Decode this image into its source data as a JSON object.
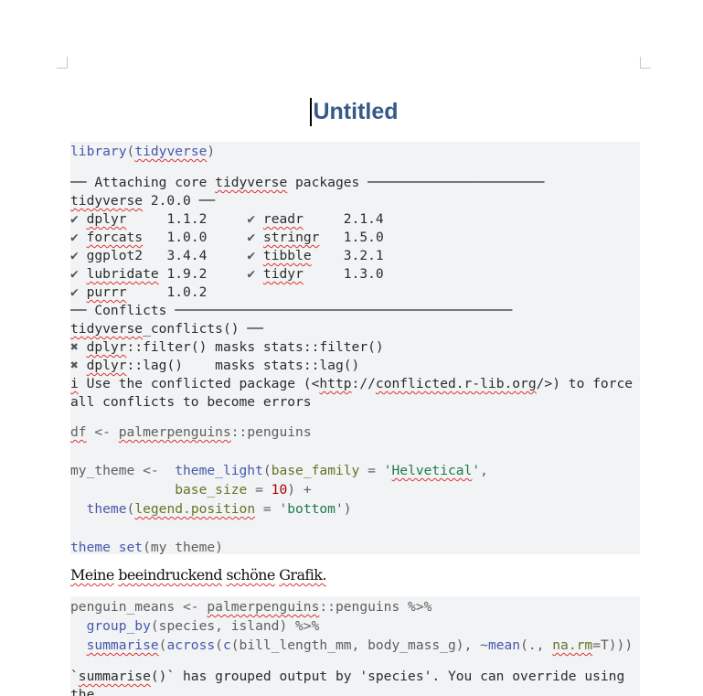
{
  "document": {
    "title": "Untitled",
    "paragraph": [
      [
        "Meine",
        "sp"
      ],
      [
        " "
      ],
      [
        "beeindruckend",
        "sp"
      ],
      [
        " "
      ],
      [
        "schöne",
        "sp"
      ],
      [
        " "
      ],
      [
        "Grafik.",
        "sp"
      ]
    ],
    "blocks": [
      {
        "chunks": [
          {
            "kind": "src",
            "gap": 0,
            "lines": [
              [
                [
                  "library",
                  "fn"
                ],
                [
                  "(",
                  "op"
                ],
                [
                  "tidyverse",
                  "fn sp"
                ],
                [
                  ")",
                  "op"
                ]
              ]
            ]
          },
          {
            "kind": "out",
            "gap": 14,
            "lines": [
              [
                [
                  "── Attaching core "
                ],
                [
                  "tidyverse",
                  "sp"
                ],
                [
                  " packages ──────────────────────"
                ]
              ],
              [
                [
                  "tidyverse",
                  "sp"
                ],
                [
                  " 2.0.0 ──"
                ]
              ],
              [
                [
                  "✔",
                  "ok"
                ],
                [
                  " "
                ],
                [
                  "dplyr",
                  "sp"
                ],
                [
                  "     1.1.2     "
                ],
                [
                  "✔",
                  "ok"
                ],
                [
                  " "
                ],
                [
                  "readr",
                  "sp"
                ],
                [
                  "     2.1.4"
                ]
              ],
              [
                [
                  "✔",
                  "ok"
                ],
                [
                  " "
                ],
                [
                  "forcats",
                  "sp"
                ],
                [
                  "   1.0.0     "
                ],
                [
                  "✔",
                  "ok"
                ],
                [
                  " "
                ],
                [
                  "stringr",
                  "sp"
                ],
                [
                  "   1.5.0"
                ]
              ],
              [
                [
                  "✔",
                  "ok"
                ],
                [
                  " ggplot2   3.4.4     "
                ],
                [
                  "✔",
                  "ok"
                ],
                [
                  " "
                ],
                [
                  "tibble",
                  "sp"
                ],
                [
                  "    3.2.1"
                ]
              ],
              [
                [
                  "✔",
                  "ok"
                ],
                [
                  " "
                ],
                [
                  "lubridate",
                  "sp"
                ],
                [
                  " 1.9.2     "
                ],
                [
                  "✔",
                  "ok"
                ],
                [
                  " "
                ],
                [
                  "tidyr",
                  "sp"
                ],
                [
                  "     1.3.0"
                ]
              ],
              [
                [
                  "✔",
                  "ok"
                ],
                [
                  " "
                ],
                [
                  "purrr",
                  "sp"
                ],
                [
                  "     1.0.2"
                ]
              ],
              [
                [
                  "── Conflicts ──────────────────────────────────────────"
                ]
              ],
              [
                [
                  "tidyverse",
                  "sp"
                ],
                [
                  "_conflicts() ──"
                ]
              ],
              [
                [
                  "✖",
                  "x"
                ],
                [
                  " "
                ],
                [
                  "dplyr",
                  "sp"
                ],
                [
                  "::filter() masks stats::filter()"
                ]
              ],
              [
                [
                  "✖",
                  "x"
                ],
                [
                  " "
                ],
                [
                  "dplyr",
                  "sp"
                ],
                [
                  "::lag()    masks stats::lag()"
                ]
              ],
              [
                [
                  "i",
                  "sp"
                ],
                [
                  " Use the conflicted package (<"
                ],
                [
                  "http",
                  "sp"
                ],
                [
                  "://"
                ],
                [
                  "conflicted.r-lib.org",
                  "sp"
                ],
                [
                  "/>) to force"
                ]
              ],
              [
                [
                  "all conflicts to become errors"
                ]
              ]
            ]
          },
          {
            "kind": "src",
            "gap": 12,
            "lines": [
              [
                [
                  "df",
                  "sp"
                ],
                [
                  " <- "
                ],
                [
                  "palmerpenguins",
                  "sp"
                ],
                [
                  "::penguins"
                ]
              ],
              [
                [
                  ""
                ]
              ],
              [
                [
                  "my_theme <-  "
                ],
                [
                  "theme_light",
                  "fn"
                ],
                [
                  "(",
                  "op"
                ],
                [
                  "base_family",
                  "ar"
                ],
                [
                  " = ",
                  "op"
                ],
                [
                  "'",
                  "st"
                ],
                [
                  "Helvetical",
                  "st sp"
                ],
                [
                  "'",
                  "st"
                ],
                [
                  ","
                ]
              ],
              [
                [
                  "             "
                ],
                [
                  "base_size",
                  "ar"
                ],
                [
                  " = ",
                  "op"
                ],
                [
                  "10",
                  "nu"
                ],
                [
                  ") +",
                  "op"
                ]
              ],
              [
                [
                  "  "
                ],
                [
                  "theme",
                  "fn"
                ],
                [
                  "(",
                  "op"
                ],
                [
                  "legend.position",
                  "ar sp"
                ],
                [
                  " = ",
                  "op"
                ],
                [
                  "'bottom'",
                  "st"
                ],
                [
                  ")",
                  "op"
                ]
              ],
              [
                [
                  ""
                ]
              ],
              [
                [
                  "theme_set",
                  "fn"
                ],
                [
                  "(my_theme)"
                ]
              ]
            ]
          }
        ]
      },
      {
        "chunks": [
          {
            "kind": "src",
            "gap": 0,
            "lines": [
              [
                [
                  "penguin_means <- "
                ],
                [
                  "palmerpenguins",
                  "sp"
                ],
                [
                  "::penguins "
                ],
                [
                  "%>%",
                  "op"
                ]
              ],
              [
                [
                  "  "
                ],
                [
                  "group_by",
                  "fn"
                ],
                [
                  "(species, island) "
                ],
                [
                  "%>%",
                  "op"
                ]
              ],
              [
                [
                  "  "
                ],
                [
                  "summarise",
                  "fn sp"
                ],
                [
                  "(",
                  "op"
                ],
                [
                  "across",
                  "fn"
                ],
                [
                  "(",
                  "op"
                ],
                [
                  "c",
                  "fn"
                ],
                [
                  "(bill_length_mm, body_mass_g), ~"
                ],
                [
                  "mean",
                  "fn"
                ],
                [
                  "(., "
                ],
                [
                  "na.rm",
                  "ar sp"
                ],
                [
                  "=T)))"
                ]
              ]
            ]
          },
          {
            "kind": "out",
            "gap": 14,
            "lines": [
              [
                [
                  "`"
                ],
                [
                  "summarise",
                  "sp"
                ],
                [
                  "()` has grouped output by 'species'. You can override using"
                ]
              ],
              [
                [
                  "the"
                ]
              ]
            ]
          }
        ]
      }
    ]
  }
}
